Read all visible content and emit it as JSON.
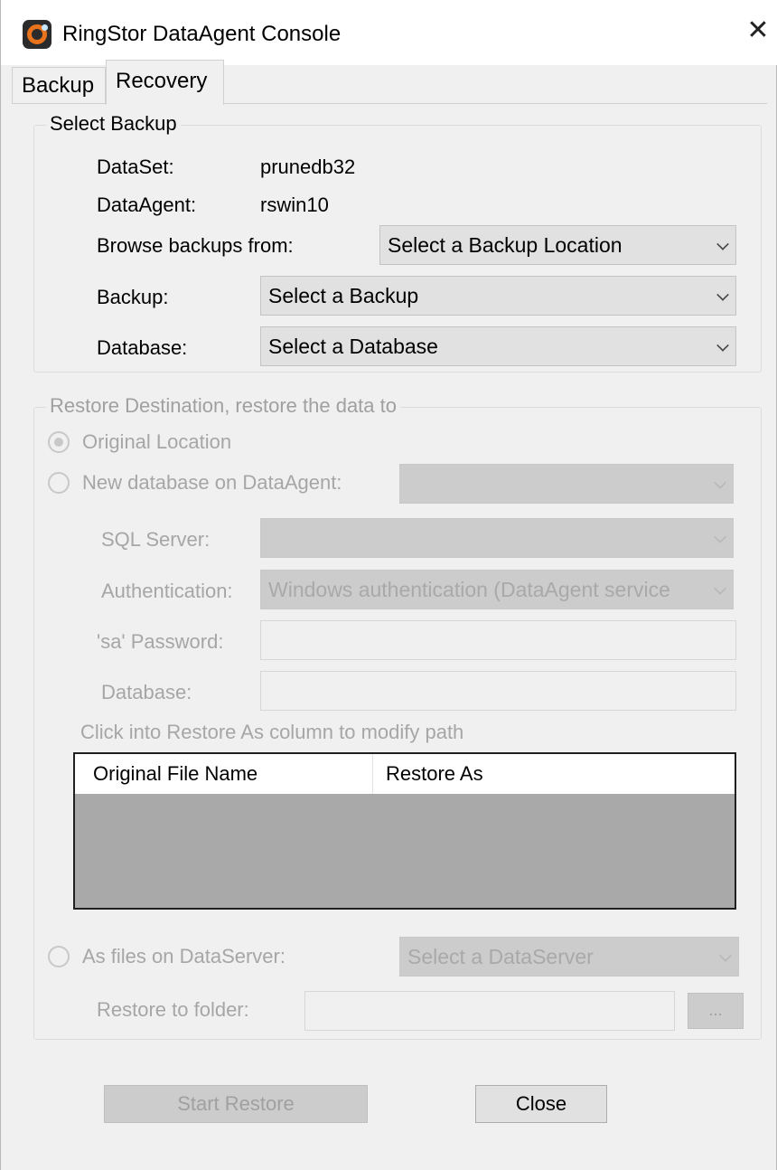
{
  "window": {
    "title": "RingStor DataAgent Console",
    "close_glyph": "✕"
  },
  "tabs": [
    {
      "label": "Backup",
      "active": false
    },
    {
      "label": "Recovery",
      "active": true
    }
  ],
  "select_backup": {
    "legend": "Select Backup",
    "dataset_label": "DataSet:",
    "dataset_value": "prunedb32",
    "dataagent_label": "DataAgent:",
    "dataagent_value": "rswin10",
    "browse_label": "Browse backups from:",
    "browse_value": "Select a Backup Location",
    "backup_label": "Backup:",
    "backup_value": "Select a Backup",
    "database_label": "Database:",
    "database_value": "Select a Database"
  },
  "restore_destination": {
    "legend": "Restore Destination, restore the data to",
    "original_location_label": "Original Location",
    "new_database_label": "New database on DataAgent:",
    "new_database_value": "",
    "sql_server_label": "SQL Server:",
    "sql_server_value": "",
    "authentication_label": "Authentication:",
    "authentication_value": "Windows authentication (DataAgent service",
    "sa_password_label": "'sa' Password:",
    "sa_password_value": "",
    "database_label": "Database:",
    "database_value": "",
    "hint": "Click into Restore As column to modify path",
    "table": {
      "columns": [
        "Original File Name",
        "Restore As"
      ],
      "rows": []
    },
    "as_files_label": "As files on DataServer:",
    "dataserver_value": "Select a DataServer",
    "restore_folder_label": "Restore to folder:",
    "restore_folder_value": "",
    "browse_button_label": "..."
  },
  "buttons": {
    "start_restore": "Start Restore",
    "close": "Close"
  },
  "colors": {
    "window_bg": "#f0f0f0",
    "disabled_text": "#a6a6a6",
    "disabled_control": "#cccccc",
    "table_body": "#a9a9a9",
    "app_icon_ring": "#e8731c"
  },
  "icons": {
    "app": "ringstor-app-icon",
    "close": "close-icon",
    "dropdown": "chevron-down-icon"
  }
}
